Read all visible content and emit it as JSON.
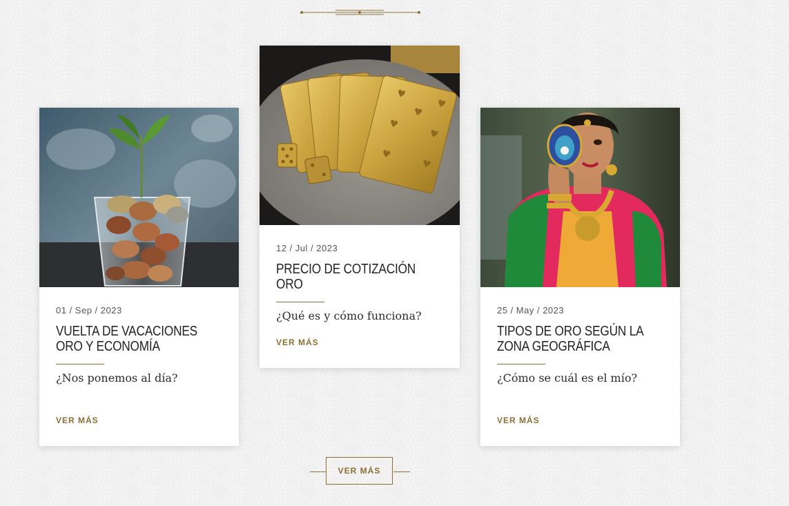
{
  "cards": [
    {
      "image_alt": "Vaso de cristal con monedas y una planta",
      "date": "01 / Sep / 2023",
      "title": "VUELTA DE VACACIONES ORO Y ECONOMÍA",
      "subtitle": "¿Nos ponemos al día?",
      "link": "VER MÁS"
    },
    {
      "image_alt": "Cartas de baraja doradas y dados dorados",
      "date": "12 / Jul / 2023",
      "title": "PRECIO DE COTIZACIÓN ORO",
      "subtitle": "¿Qué es y cómo funciona?",
      "link": "VER MÁS"
    },
    {
      "image_alt": "Mujer con sari y joyas de oro",
      "date": "25 / May / 2023",
      "title": "TIPOS DE ORO SEGÚN LA ZONA GEOGRÁFICA",
      "subtitle": "¿Cómo se cuál es el mío?",
      "link": "VER MÁS"
    }
  ],
  "more_button": "VER MÁS",
  "colors": {
    "accent": "#8a6f33",
    "background": "#f0f0f1",
    "card": "#ffffff"
  }
}
